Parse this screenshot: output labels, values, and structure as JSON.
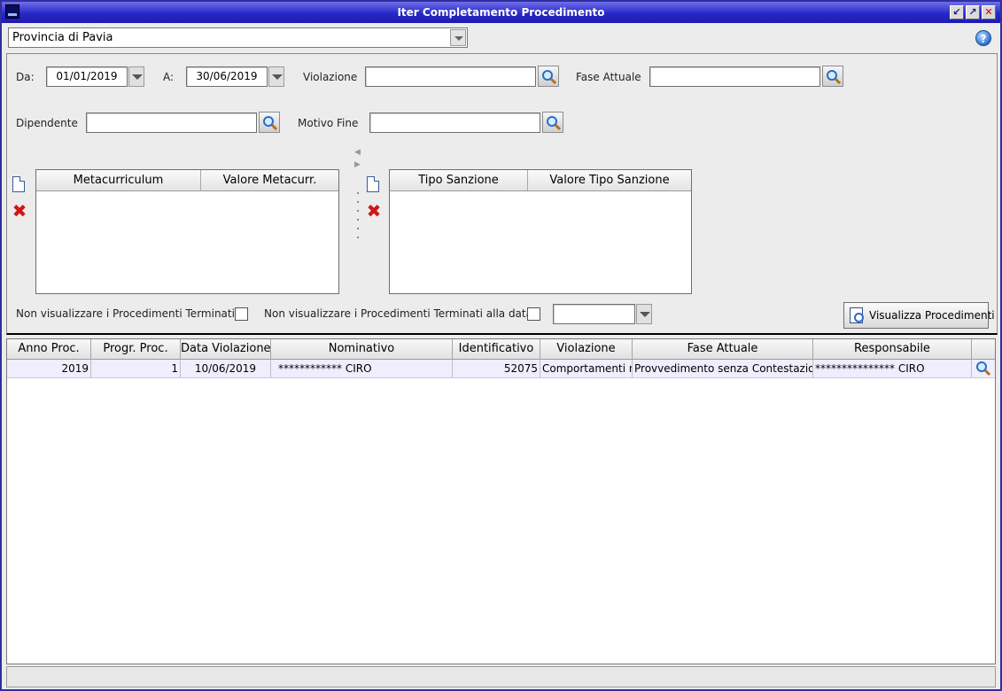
{
  "window": {
    "title": "Iter Completamento Procedimento"
  },
  "org_selector": {
    "value": "Provincia di Pavia"
  },
  "filters": {
    "da_label": "Da:",
    "da_value": "01/01/2019",
    "a_label": "A:",
    "a_value": "30/06/2019",
    "violazione_label": "Violazione",
    "violazione_value": "",
    "fase_attuale_label": "Fase Attuale",
    "fase_attuale_value": "",
    "dipendente_label": "Dipendente",
    "dipendente_value": "",
    "motivo_fine_label": "Motivo Fine",
    "motivo_fine_value": ""
  },
  "meta_grid": {
    "columns": [
      "Metacurriculum",
      "Valore Metacurr."
    ]
  },
  "sanzione_grid": {
    "columns": [
      "Tipo Sanzione",
      "Valore Tipo Sanzione"
    ]
  },
  "options": {
    "hide_terminated_label": "Non visualizzare i Procedimenti Terminati",
    "hide_terminated_checked": false,
    "hide_terminated_date_label": "Non visualizzare i Procedimenti Terminati alla data",
    "hide_terminated_date_checked": false,
    "date_value": ""
  },
  "visualizza_button": {
    "label": "Visualizza Procedimenti"
  },
  "results": {
    "columns": [
      "Anno Proc.",
      "Progr. Proc.",
      "Data Violazione",
      "Nominativo",
      "Identificativo",
      "Violazione",
      "Fase Attuale",
      "Responsabile"
    ],
    "rows": [
      {
        "anno": "2019",
        "progr": "1",
        "data_violazione": "10/06/2019",
        "nominativo": "************  CIRO",
        "identificativo": "52075",
        "violazione": "Comportamenti non",
        "fase_attuale": "Provvedimento senza Contestazione",
        "responsabile": "***************  CIRO"
      }
    ]
  },
  "icons": {
    "search": "magnifier-icon",
    "new": "new-document-icon",
    "delete": "delete-x-icon",
    "help": "help-icon"
  }
}
